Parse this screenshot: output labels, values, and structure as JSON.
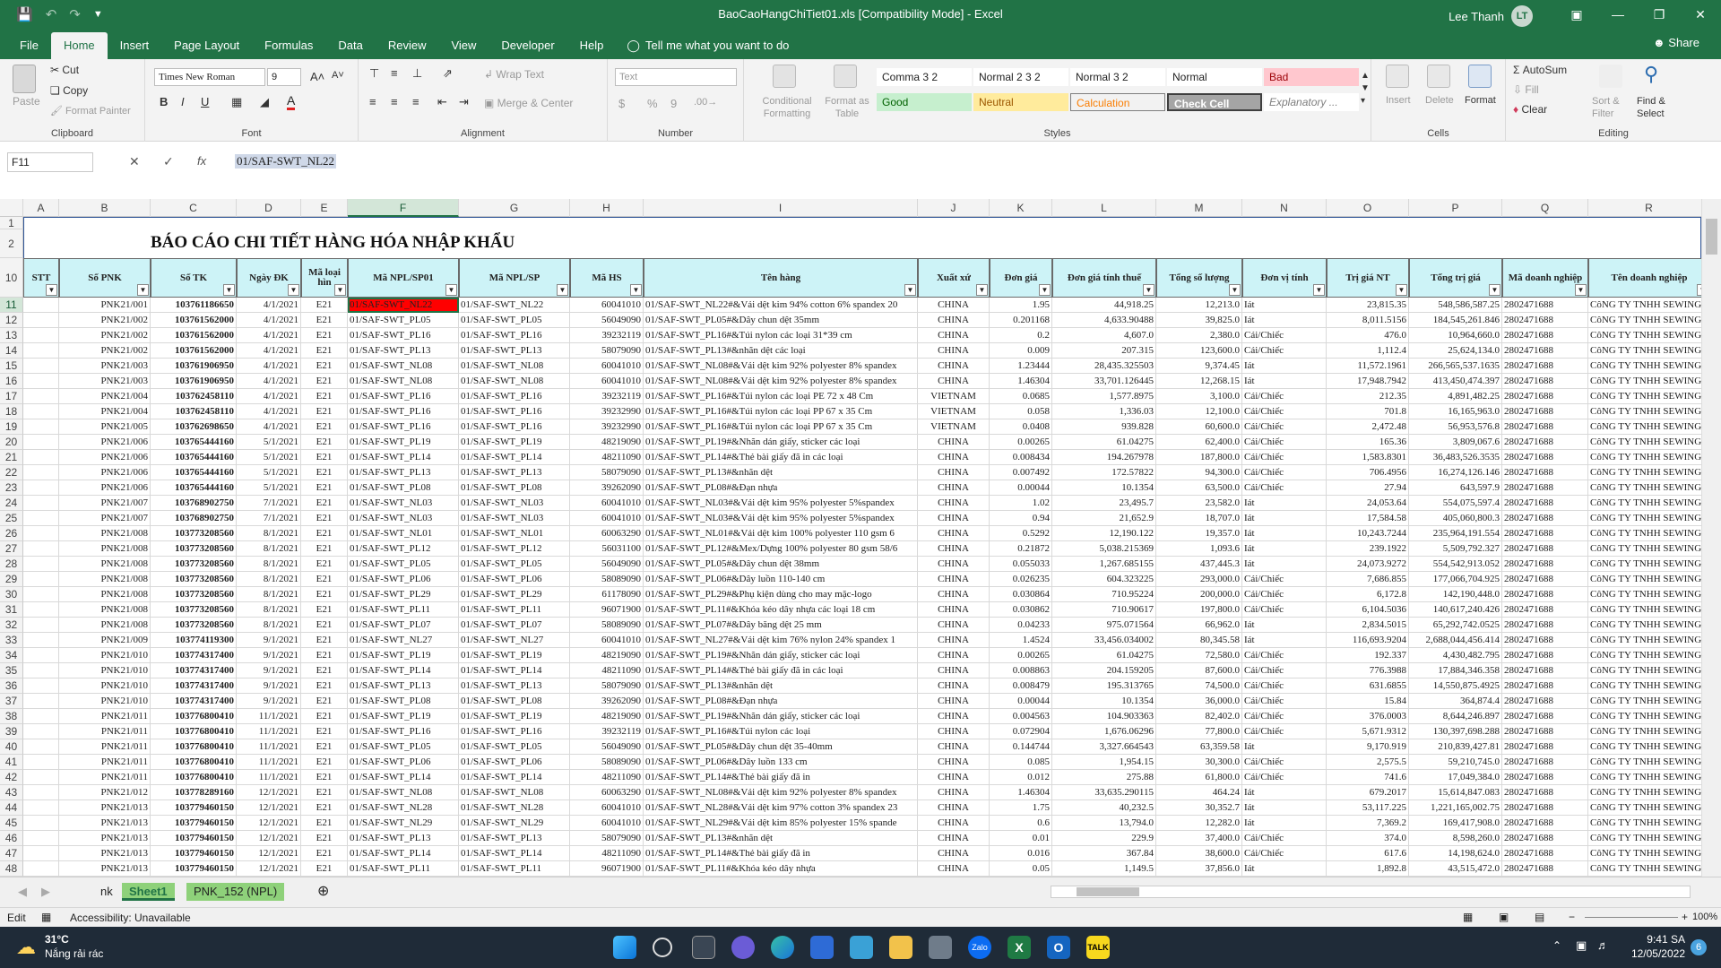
{
  "window": {
    "title": "BaoCaoHangChiTiet01.xls [Compatibility Mode] - Excel",
    "user": "Lee Thanh",
    "user_initials": "LT"
  },
  "menu": {
    "tabs": [
      "File",
      "Home",
      "Insert",
      "Page Layout",
      "Formulas",
      "Data",
      "Review",
      "View",
      "Developer",
      "Help"
    ],
    "active": "Home",
    "tell_me": "Tell me what you want to do",
    "share": "Share"
  },
  "ribbon": {
    "clipboard": {
      "label": "Clipboard",
      "paste": "Paste",
      "cut": "Cut",
      "copy": "Copy",
      "format_painter": "Format Painter"
    },
    "font": {
      "label": "Font",
      "name": "Times New Roman",
      "size": "9",
      "bold": "B",
      "italic": "I",
      "underline": "U"
    },
    "alignment": {
      "label": "Alignment",
      "wrap": "Wrap Text",
      "merge": "Merge & Center"
    },
    "number": {
      "label": "Number",
      "format": "Text",
      "percent": "%",
      "comma": "9"
    },
    "styles": {
      "label": "Styles",
      "conditional": "Conditional Formatting",
      "format_table": "Format as Table",
      "cells_row1": [
        "Comma 3 2",
        "Normal 2 3 2",
        "Normal 3 2",
        "Normal",
        "Bad"
      ],
      "cells_row2": [
        "Good",
        "Neutral",
        "Calculation",
        "Check Cell",
        "Explanatory ..."
      ]
    },
    "cells": {
      "label": "Cells",
      "insert": "Insert",
      "delete": "Delete",
      "format": "Format"
    },
    "editing": {
      "label": "Editing",
      "autosum": "AutoSum",
      "fill": "Fill",
      "clear": "Clear",
      "sort": "Sort & Filter",
      "find": "Find & Select"
    }
  },
  "formula_bar": {
    "namebox": "F11",
    "value": "01/SAF-SWT_NL22"
  },
  "columns": [
    "A",
    "B",
    "C",
    "D",
    "E",
    "F",
    "G",
    "H",
    "I",
    "J",
    "K",
    "L",
    "M",
    "N",
    "O",
    "P",
    "Q",
    "R"
  ],
  "report_title": "BÁO CÁO CHI TIẾT HÀNG HÓA NHẬP KHẨU",
  "headers": [
    "STT",
    "Số PNK",
    "Số TK",
    "Ngày ĐK",
    "Mã loại hìn",
    "Mã NPL/SP01",
    "Mã NPL/SP",
    "Mã HS",
    "Tên hàng",
    "Xuất xứ",
    "Đơn giá",
    "Đơn giá tính thuế",
    "Tổng số lượng",
    "Đơn vị tính",
    "Trị giá NT",
    "Tổng trị giá",
    "Mã doanh nghiệp",
    "Tên doanh nghiệp"
  ],
  "rows": [
    [
      "",
      "PNK21/001",
      "103761186650",
      "4/1/2021",
      "E21",
      "01/SAF-SWT_NL22",
      "01/SAF-SWT_NL22",
      "60041010",
      "01/SAF-SWT_NL22#&Vải dệt kim 94% cotton 6% spandex 20",
      "CHINA",
      "1.95",
      "44,918.25",
      "12,213.0",
      "Iát",
      "23,815.35",
      "548,586,587.25",
      "2802471688",
      "CôNG TY TNHH SEWING"
    ],
    [
      "",
      "PNK21/002",
      "103761562000",
      "4/1/2021",
      "E21",
      "01/SAF-SWT_PL05",
      "01/SAF-SWT_PL05",
      "56049090",
      "01/SAF-SWT_PL05#&Dây chun dệt 35mm",
      "CHINA",
      "0.201168",
      "4,633.90488",
      "39,825.0",
      "Iát",
      "8,011.5156",
      "184,545,261.846",
      "2802471688",
      "CôNG TY TNHH SEWING"
    ],
    [
      "",
      "PNK21/002",
      "103761562000",
      "4/1/2021",
      "E21",
      "01/SAF-SWT_PL16",
      "01/SAF-SWT_PL16",
      "39232119",
      "01/SAF-SWT_PL16#&Túi nylon các loại 31*39 cm",
      "CHINA",
      "0.2",
      "4,607.0",
      "2,380.0",
      "Cái/Chiếc",
      "476.0",
      "10,964,660.0",
      "2802471688",
      "CôNG TY TNHH SEWING"
    ],
    [
      "",
      "PNK21/002",
      "103761562000",
      "4/1/2021",
      "E21",
      "01/SAF-SWT_PL13",
      "01/SAF-SWT_PL13",
      "58079090",
      "01/SAF-SWT_PL13#&nhãn dệt các loại",
      "CHINA",
      "0.009",
      "207.315",
      "123,600.0",
      "Cái/Chiếc",
      "1,112.4",
      "25,624,134.0",
      "2802471688",
      "CôNG TY TNHH SEWING"
    ],
    [
      "",
      "PNK21/003",
      "103761906950",
      "4/1/2021",
      "E21",
      "01/SAF-SWT_NL08",
      "01/SAF-SWT_NL08",
      "60041010",
      "01/SAF-SWT_NL08#&Vải dệt kim 92% polyester 8% spandex",
      "CHINA",
      "1.23444",
      "28,435.325503",
      "9,374.45",
      "Iát",
      "11,572.1961",
      "266,565,537.1635",
      "2802471688",
      "CôNG TY TNHH SEWING"
    ],
    [
      "",
      "PNK21/003",
      "103761906950",
      "4/1/2021",
      "E21",
      "01/SAF-SWT_NL08",
      "01/SAF-SWT_NL08",
      "60041010",
      "01/SAF-SWT_NL08#&Vải dệt kim 92% polyester 8% spandex",
      "CHINA",
      "1.46304",
      "33,701.126445",
      "12,268.15",
      "Iát",
      "17,948.7942",
      "413,450,474.397",
      "2802471688",
      "CôNG TY TNHH SEWING"
    ],
    [
      "",
      "PNK21/004",
      "103762458110",
      "4/1/2021",
      "E21",
      "01/SAF-SWT_PL16",
      "01/SAF-SWT_PL16",
      "39232119",
      "01/SAF-SWT_PL16#&Túi nylon các loại PE 72 x 48 Cm",
      "VIETNAM",
      "0.0685",
      "1,577.8975",
      "3,100.0",
      "Cái/Chiếc",
      "212.35",
      "4,891,482.25",
      "2802471688",
      "CôNG TY TNHH SEWING"
    ],
    [
      "",
      "PNK21/004",
      "103762458110",
      "4/1/2021",
      "E21",
      "01/SAF-SWT_PL16",
      "01/SAF-SWT_PL16",
      "39232990",
      "01/SAF-SWT_PL16#&Túi nylon các loại PP 67 x 35 Cm",
      "VIETNAM",
      "0.058",
      "1,336.03",
      "12,100.0",
      "Cái/Chiếc",
      "701.8",
      "16,165,963.0",
      "2802471688",
      "CôNG TY TNHH SEWING"
    ],
    [
      "",
      "PNK21/005",
      "103762698650",
      "4/1/2021",
      "E21",
      "01/SAF-SWT_PL16",
      "01/SAF-SWT_PL16",
      "39232990",
      "01/SAF-SWT_PL16#&Túi nylon các loại PP 67 x 35 Cm",
      "VIETNAM",
      "0.0408",
      "939.828",
      "60,600.0",
      "Cái/Chiếc",
      "2,472.48",
      "56,953,576.8",
      "2802471688",
      "CôNG TY TNHH SEWING"
    ],
    [
      "",
      "PNK21/006",
      "103765444160",
      "5/1/2021",
      "E21",
      "01/SAF-SWT_PL19",
      "01/SAF-SWT_PL19",
      "48219090",
      "01/SAF-SWT_PL19#&Nhãn dán giấy, sticker các loại",
      "CHINA",
      "0.00265",
      "61.04275",
      "62,400.0",
      "Cái/Chiếc",
      "165.36",
      "3,809,067.6",
      "2802471688",
      "CôNG TY TNHH SEWING"
    ],
    [
      "",
      "PNK21/006",
      "103765444160",
      "5/1/2021",
      "E21",
      "01/SAF-SWT_PL14",
      "01/SAF-SWT_PL14",
      "48211090",
      "01/SAF-SWT_PL14#&Thẻ bài giấy đã in các loại",
      "CHINA",
      "0.008434",
      "194.267978",
      "187,800.0",
      "Cái/Chiếc",
      "1,583.8301",
      "36,483,526.3535",
      "2802471688",
      "CôNG TY TNHH SEWING"
    ],
    [
      "",
      "PNK21/006",
      "103765444160",
      "5/1/2021",
      "E21",
      "01/SAF-SWT_PL13",
      "01/SAF-SWT_PL13",
      "58079090",
      "01/SAF-SWT_PL13#&nhãn dệt",
      "CHINA",
      "0.007492",
      "172.57822",
      "94,300.0",
      "Cái/Chiếc",
      "706.4956",
      "16,274,126.146",
      "2802471688",
      "CôNG TY TNHH SEWING"
    ],
    [
      "",
      "PNK21/006",
      "103765444160",
      "5/1/2021",
      "E21",
      "01/SAF-SWT_PL08",
      "01/SAF-SWT_PL08",
      "39262090",
      "01/SAF-SWT_PL08#&Đạn nhựa",
      "CHINA",
      "0.00044",
      "10.1354",
      "63,500.0",
      "Cái/Chiếc",
      "27.94",
      "643,597.9",
      "2802471688",
      "CôNG TY TNHH SEWING"
    ],
    [
      "",
      "PNK21/007",
      "103768902750",
      "7/1/2021",
      "E21",
      "01/SAF-SWT_NL03",
      "01/SAF-SWT_NL03",
      "60041010",
      "01/SAF-SWT_NL03#&Vải dệt kim 95% polyester 5%spandex",
      "CHINA",
      "1.02",
      "23,495.7",
      "23,582.0",
      "Iát",
      "24,053.64",
      "554,075,597.4",
      "2802471688",
      "CôNG TY TNHH SEWING"
    ],
    [
      "",
      "PNK21/007",
      "103768902750",
      "7/1/2021",
      "E21",
      "01/SAF-SWT_NL03",
      "01/SAF-SWT_NL03",
      "60041010",
      "01/SAF-SWT_NL03#&Vải dệt kim 95% polyester 5%spandex",
      "CHINA",
      "0.94",
      "21,652.9",
      "18,707.0",
      "Iát",
      "17,584.58",
      "405,060,800.3",
      "2802471688",
      "CôNG TY TNHH SEWING"
    ],
    [
      "",
      "PNK21/008",
      "103773208560",
      "8/1/2021",
      "E21",
      "01/SAF-SWT_NL01",
      "01/SAF-SWT_NL01",
      "60063290",
      "01/SAF-SWT_NL01#&Vải dệt kim 100% polyester 110 gsm 6",
      "CHINA",
      "0.5292",
      "12,190.122",
      "19,357.0",
      "Iát",
      "10,243.7244",
      "235,964,191.554",
      "2802471688",
      "CôNG TY TNHH SEWING"
    ],
    [
      "",
      "PNK21/008",
      "103773208560",
      "8/1/2021",
      "E21",
      "01/SAF-SWT_PL12",
      "01/SAF-SWT_PL12",
      "56031100",
      "01/SAF-SWT_PL12#&Mex/Dựng 100% polyester 80 gsm 58/6",
      "CHINA",
      "0.21872",
      "5,038.215369",
      "1,093.6",
      "Iát",
      "239.1922",
      "5,509,792.327",
      "2802471688",
      "CôNG TY TNHH SEWING"
    ],
    [
      "",
      "PNK21/008",
      "103773208560",
      "8/1/2021",
      "E21",
      "01/SAF-SWT_PL05",
      "01/SAF-SWT_PL05",
      "56049090",
      "01/SAF-SWT_PL05#&Dây chun dệt 38mm",
      "CHINA",
      "0.055033",
      "1,267.685155",
      "437,445.3",
      "Iát",
      "24,073.9272",
      "554,542,913.052",
      "2802471688",
      "CôNG TY TNHH SEWING"
    ],
    [
      "",
      "PNK21/008",
      "103773208560",
      "8/1/2021",
      "E21",
      "01/SAF-SWT_PL06",
      "01/SAF-SWT_PL06",
      "58089090",
      "01/SAF-SWT_PL06#&Dây luồn 110-140 cm",
      "CHINA",
      "0.026235",
      "604.323225",
      "293,000.0",
      "Cái/Chiếc",
      "7,686.855",
      "177,066,704.925",
      "2802471688",
      "CôNG TY TNHH SEWING"
    ],
    [
      "",
      "PNK21/008",
      "103773208560",
      "8/1/2021",
      "E21",
      "01/SAF-SWT_PL29",
      "01/SAF-SWT_PL29",
      "61178090",
      "01/SAF-SWT_PL29#&Phụ kiện dùng cho may mặc-logo",
      "CHINA",
      "0.030864",
      "710.95224",
      "200,000.0",
      "Cái/Chiếc",
      "6,172.8",
      "142,190,448.0",
      "2802471688",
      "CôNG TY TNHH SEWING"
    ],
    [
      "",
      "PNK21/008",
      "103773208560",
      "8/1/2021",
      "E21",
      "01/SAF-SWT_PL11",
      "01/SAF-SWT_PL11",
      "96071900",
      "01/SAF-SWT_PL11#&Khóa kéo dây nhựa các loại 18 cm",
      "CHINA",
      "0.030862",
      "710.90617",
      "197,800.0",
      "Cái/Chiếc",
      "6,104.5036",
      "140,617,240.426",
      "2802471688",
      "CôNG TY TNHH SEWING"
    ],
    [
      "",
      "PNK21/008",
      "103773208560",
      "8/1/2021",
      "E21",
      "01/SAF-SWT_PL07",
      "01/SAF-SWT_PL07",
      "58089090",
      "01/SAF-SWT_PL07#&Dây băng dệt 25 mm",
      "CHINA",
      "0.04233",
      "975.071564",
      "66,962.0",
      "Iát",
      "2,834.5015",
      "65,292,742.0525",
      "2802471688",
      "CôNG TY TNHH SEWING"
    ],
    [
      "",
      "PNK21/009",
      "103774119300",
      "9/1/2021",
      "E21",
      "01/SAF-SWT_NL27",
      "01/SAF-SWT_NL27",
      "60041010",
      "01/SAF-SWT_NL27#&Vải dệt kim 76% nylon 24% spandex 1",
      "CHINA",
      "1.4524",
      "33,456.034002",
      "80,345.58",
      "Iát",
      "116,693.9204",
      "2,688,044,456.414",
      "2802471688",
      "CôNG TY TNHH SEWING"
    ],
    [
      "",
      "PNK21/010",
      "103774317400",
      "9/1/2021",
      "E21",
      "01/SAF-SWT_PL19",
      "01/SAF-SWT_PL19",
      "48219090",
      "01/SAF-SWT_PL19#&Nhãn dán giấy, sticker các loại",
      "CHINA",
      "0.00265",
      "61.04275",
      "72,580.0",
      "Cái/Chiếc",
      "192.337",
      "4,430,482.795",
      "2802471688",
      "CôNG TY TNHH SEWING"
    ],
    [
      "",
      "PNK21/010",
      "103774317400",
      "9/1/2021",
      "E21",
      "01/SAF-SWT_PL14",
      "01/SAF-SWT_PL14",
      "48211090",
      "01/SAF-SWT_PL14#&Thẻ bài giấy đã in các loại",
      "CHINA",
      "0.008863",
      "204.159205",
      "87,600.0",
      "Cái/Chiếc",
      "776.3988",
      "17,884,346.358",
      "2802471688",
      "CôNG TY TNHH SEWING"
    ],
    [
      "",
      "PNK21/010",
      "103774317400",
      "9/1/2021",
      "E21",
      "01/SAF-SWT_PL13",
      "01/SAF-SWT_PL13",
      "58079090",
      "01/SAF-SWT_PL13#&nhãn dệt",
      "CHINA",
      "0.008479",
      "195.313765",
      "74,500.0",
      "Cái/Chiếc",
      "631.6855",
      "14,550,875.4925",
      "2802471688",
      "CôNG TY TNHH SEWING"
    ],
    [
      "",
      "PNK21/010",
      "103774317400",
      "9/1/2021",
      "E21",
      "01/SAF-SWT_PL08",
      "01/SAF-SWT_PL08",
      "39262090",
      "01/SAF-SWT_PL08#&Đạn nhựa",
      "CHINA",
      "0.00044",
      "10.1354",
      "36,000.0",
      "Cái/Chiếc",
      "15.84",
      "364,874.4",
      "2802471688",
      "CôNG TY TNHH SEWING"
    ],
    [
      "",
      "PNK21/011",
      "103776800410",
      "11/1/2021",
      "E21",
      "01/SAF-SWT_PL19",
      "01/SAF-SWT_PL19",
      "48219090",
      "01/SAF-SWT_PL19#&Nhãn dán giấy, sticker các loại",
      "CHINA",
      "0.004563",
      "104.903363",
      "82,402.0",
      "Cái/Chiếc",
      "376.0003",
      "8,644,246.897",
      "2802471688",
      "CôNG TY TNHH SEWING"
    ],
    [
      "",
      "PNK21/011",
      "103776800410",
      "11/1/2021",
      "E21",
      "01/SAF-SWT_PL16",
      "01/SAF-SWT_PL16",
      "39232119",
      "01/SAF-SWT_PL16#&Túi nylon các loại",
      "CHINA",
      "0.072904",
      "1,676.06296",
      "77,800.0",
      "Cái/Chiếc",
      "5,671.9312",
      "130,397,698.288",
      "2802471688",
      "CôNG TY TNHH SEWING"
    ],
    [
      "",
      "PNK21/011",
      "103776800410",
      "11/1/2021",
      "E21",
      "01/SAF-SWT_PL05",
      "01/SAF-SWT_PL05",
      "56049090",
      "01/SAF-SWT_PL05#&Dây chun dệt 35-40mm",
      "CHINA",
      "0.144744",
      "3,327.664543",
      "63,359.58",
      "Iát",
      "9,170.919",
      "210,839,427.81",
      "2802471688",
      "CôNG TY TNHH SEWING"
    ],
    [
      "",
      "PNK21/011",
      "103776800410",
      "11/1/2021",
      "E21",
      "01/SAF-SWT_PL06",
      "01/SAF-SWT_PL06",
      "58089090",
      "01/SAF-SWT_PL06#&Dây luồn 133 cm",
      "CHINA",
      "0.085",
      "1,954.15",
      "30,300.0",
      "Cái/Chiếc",
      "2,575.5",
      "59,210,745.0",
      "2802471688",
      "CôNG TY TNHH SEWING"
    ],
    [
      "",
      "PNK21/011",
      "103776800410",
      "11/1/2021",
      "E21",
      "01/SAF-SWT_PL14",
      "01/SAF-SWT_PL14",
      "48211090",
      "01/SAF-SWT_PL14#&Thẻ bài giấy đã in",
      "CHINA",
      "0.012",
      "275.88",
      "61,800.0",
      "Cái/Chiếc",
      "741.6",
      "17,049,384.0",
      "2802471688",
      "CôNG TY TNHH SEWING"
    ],
    [
      "",
      "PNK21/012",
      "103778289160",
      "12/1/2021",
      "E21",
      "01/SAF-SWT_NL08",
      "01/SAF-SWT_NL08",
      "60063290",
      "01/SAF-SWT_NL08#&Vải dệt kim 92% polyester 8% spandex",
      "CHINA",
      "1.46304",
      "33,635.290115",
      "464.24",
      "Iát",
      "679.2017",
      "15,614,847.083",
      "2802471688",
      "CôNG TY TNHH SEWING"
    ],
    [
      "",
      "PNK21/013",
      "103779460150",
      "12/1/2021",
      "E21",
      "01/SAF-SWT_NL28",
      "01/SAF-SWT_NL28",
      "60041010",
      "01/SAF-SWT_NL28#&Vải dệt kim 97% cotton 3% spandex 23",
      "CHINA",
      "1.75",
      "40,232.5",
      "30,352.7",
      "Iát",
      "53,117.225",
      "1,221,165,002.75",
      "2802471688",
      "CôNG TY TNHH SEWING"
    ],
    [
      "",
      "PNK21/013",
      "103779460150",
      "12/1/2021",
      "E21",
      "01/SAF-SWT_NL29",
      "01/SAF-SWT_NL29",
      "60041010",
      "01/SAF-SWT_NL29#&Vải dệt kim 85% polyester 15% spande",
      "CHINA",
      "0.6",
      "13,794.0",
      "12,282.0",
      "Iát",
      "7,369.2",
      "169,417,908.0",
      "2802471688",
      "CôNG TY TNHH SEWING"
    ],
    [
      "",
      "PNK21/013",
      "103779460150",
      "12/1/2021",
      "E21",
      "01/SAF-SWT_PL13",
      "01/SAF-SWT_PL13",
      "58079090",
      "01/SAF-SWT_PL13#&nhãn dệt",
      "CHINA",
      "0.01",
      "229.9",
      "37,400.0",
      "Cái/Chiếc",
      "374.0",
      "8,598,260.0",
      "2802471688",
      "CôNG TY TNHH SEWING"
    ],
    [
      "",
      "PNK21/013",
      "103779460150",
      "12/1/2021",
      "E21",
      "01/SAF-SWT_PL14",
      "01/SAF-SWT_PL14",
      "48211090",
      "01/SAF-SWT_PL14#&Thẻ bài giấy đã in",
      "CHINA",
      "0.016",
      "367.84",
      "38,600.0",
      "Cái/Chiếc",
      "617.6",
      "14,198,624.0",
      "2802471688",
      "CôNG TY TNHH SEWING"
    ],
    [
      "",
      "PNK21/013",
      "103779460150",
      "12/1/2021",
      "E21",
      "01/SAF-SWT_PL11",
      "01/SAF-SWT_PL11",
      "96071900",
      "01/SAF-SWT_PL11#&Khóa kéo dây nhựa",
      "CHINA",
      "0.05",
      "1,149.5",
      "37,856.0",
      "Iát",
      "1,892.8",
      "43,515,472.0",
      "2802471688",
      "CôNG TY TNHH SEWING"
    ]
  ],
  "row_numbers": [
    "11",
    "12",
    "13",
    "14",
    "15",
    "16",
    "17",
    "18",
    "19",
    "20",
    "21",
    "22",
    "23",
    "24",
    "25",
    "26",
    "27",
    "28",
    "29",
    "30",
    "31",
    "32",
    "33",
    "34",
    "35",
    "36",
    "37",
    "38",
    "39",
    "40",
    "41",
    "42",
    "43",
    "44",
    "45",
    "46",
    "47",
    "48"
  ],
  "sheet_tabs": [
    "nk",
    "Sheet1",
    "PNK_152 (NPL)"
  ],
  "active_sheet": "Sheet1",
  "status": {
    "mode": "Edit",
    "accessibility": "Accessibility: Unavailable",
    "zoom": "100%"
  },
  "taskbar": {
    "weather_temp": "31°C",
    "weather_text": "Nắng rải rác",
    "time": "9:41 SA",
    "date": "12/05/2022",
    "notif": "6"
  }
}
